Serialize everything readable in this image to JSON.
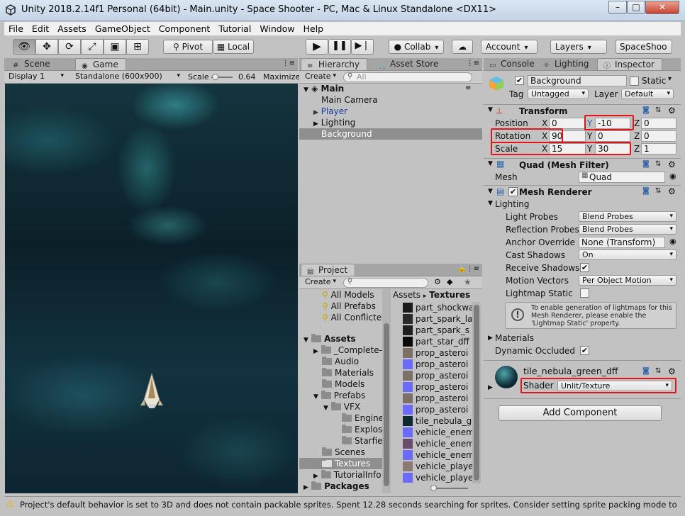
{
  "window": {
    "title": "Unity 2018.2.14f1 Personal (64bit) - Main.unity - Space Shooter - PC, Mac & Linux Standalone <DX11>",
    "minimize": "–",
    "maximize": "□",
    "close": "✕"
  },
  "menu": [
    "File",
    "Edit",
    "Assets",
    "GameObject",
    "Component",
    "Tutorial",
    "Window",
    "Help"
  ],
  "toolbar": {
    "pivot": "Pivot",
    "local": "Local",
    "collab": "Collab",
    "account": "Account",
    "layers": "Layers",
    "layout": "SpaceShoo"
  },
  "scene_panel": {
    "tabs": [
      "Scene",
      "Game"
    ],
    "display": "Display 1",
    "resolution": "Standalone (600x900)",
    "scale_label": "Scale",
    "scale_value": "0.64",
    "maximize": "Maximize"
  },
  "hierarchy": {
    "tabs": [
      "Hierarchy",
      "Asset Store"
    ],
    "create": "Create",
    "search_placeholder": "All",
    "scene": "Main",
    "items": [
      "Main Camera",
      "Player",
      "Lighting",
      "Background"
    ]
  },
  "project": {
    "tab": "Project",
    "create": "Create",
    "favorites": [
      "All Models",
      "All Prefabs",
      "All Conflicte"
    ],
    "assets_root": "Assets",
    "folders": [
      "_Complete-",
      "Audio",
      "Materials",
      "Models",
      "Prefabs",
      "VFX",
      "Engines",
      "Explosi",
      "Starfiel",
      "Scenes",
      "Textures",
      "TutorialInfo"
    ],
    "packages": "Packages",
    "breadcrumb_root": "Assets",
    "breadcrumb_current": "Textures",
    "files": [
      "part_shockwa",
      "part_spark_la",
      "part_spark_s",
      "part_star_dff",
      "prop_asteroi",
      "prop_asteroi",
      "prop_asteroi",
      "prop_asteroi",
      "prop_asteroi",
      "prop_asteroi",
      "tile_nebula_g",
      "vehicle_enem",
      "vehicle_enem",
      "vehicle_enem",
      "vehicle_playe",
      "vehicle_playe"
    ]
  },
  "inspector": {
    "tabs": [
      "Console",
      "Lighting",
      "Inspector"
    ],
    "object_name": "Background",
    "static_label": "Static",
    "tag_label": "Tag",
    "tag_value": "Untagged",
    "layer_label": "Layer",
    "layer_value": "Default",
    "transform": {
      "title": "Transform",
      "position_label": "Position",
      "rotation_label": "Rotation",
      "scale_label": "Scale",
      "px": "0",
      "py": "-10",
      "pz": "0",
      "rx": "90",
      "ry": "0",
      "rz": "0",
      "sx": "15",
      "sy": "30",
      "sz": "1"
    },
    "mesh_filter": {
      "title": "Quad (Mesh Filter)",
      "mesh_label": "Mesh",
      "mesh_value": "Quad"
    },
    "mesh_renderer": {
      "title": "Mesh Renderer",
      "lighting": "Lighting",
      "light_probes_label": "Light Probes",
      "light_probes": "Blend Probes",
      "reflection_probes_label": "Reflection Probes",
      "reflection_probes": "Blend Probes",
      "anchor_override_label": "Anchor Override",
      "anchor_override": "None (Transform)",
      "cast_shadows_label": "Cast Shadows",
      "cast_shadows": "On",
      "receive_shadows_label": "Receive Shadows",
      "motion_vectors_label": "Motion Vectors",
      "motion_vectors": "Per Object Motion",
      "lightmap_static_label": "Lightmap Static",
      "info": "To enable generation of lightmaps for this Mesh Renderer, please enable the 'Lightmap Static' property.",
      "materials": "Materials",
      "dynamic_occluded": "Dynamic Occluded"
    },
    "material": {
      "name": "tile_nebula_green_dff",
      "shader_label": "Shader",
      "shader_value": "Unlit/Texture"
    },
    "add_component": "Add Component"
  },
  "status": "Project's default behavior is set to 3D and does not contain packable sprites. Spent 12.28 seconds searching for sprites. Consider setting sprite packing mode to 'D"
}
